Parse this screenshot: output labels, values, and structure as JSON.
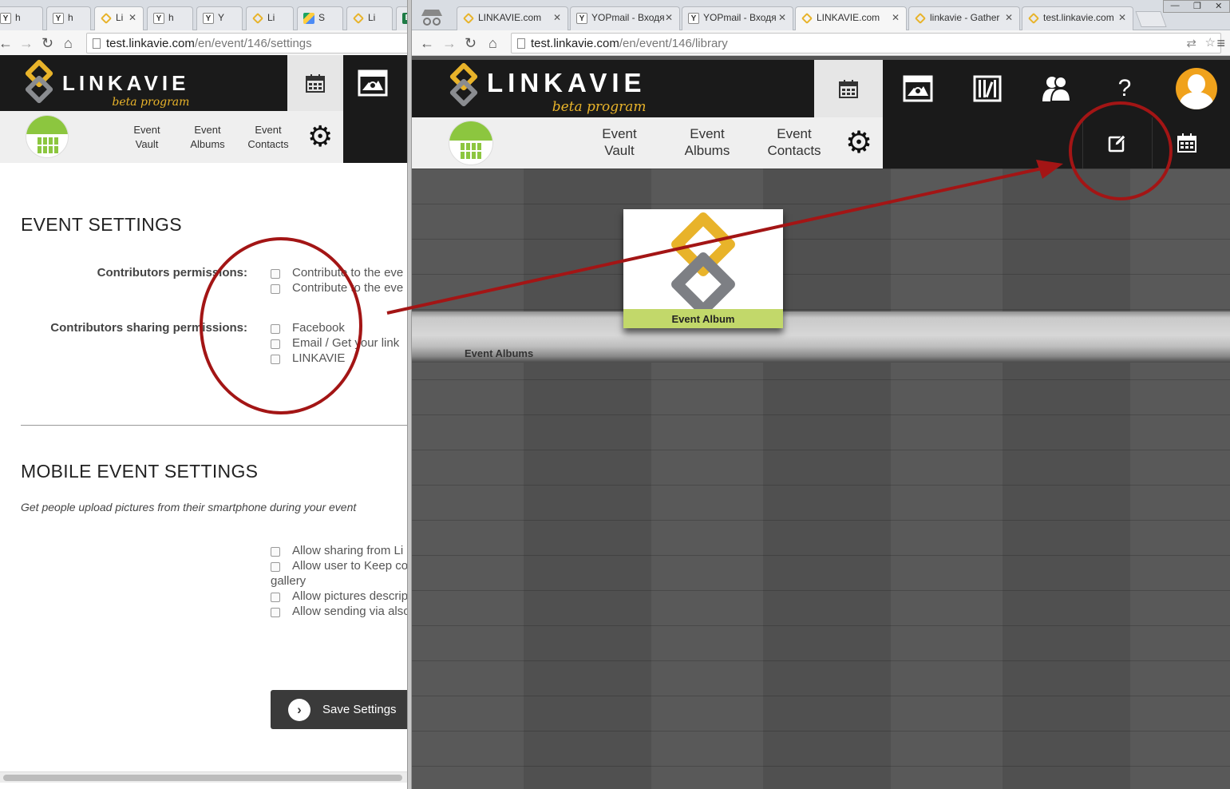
{
  "left_window": {
    "tabs": [
      {
        "icon": "Y",
        "label": "h"
      },
      {
        "icon": "Y",
        "label": "h"
      },
      {
        "icon": "L",
        "label": "Li"
      },
      {
        "icon": "Y",
        "label": "h"
      },
      {
        "icon": "Y",
        "label": "Y"
      },
      {
        "icon": "L",
        "label": "Li"
      },
      {
        "icon": "G",
        "label": "S"
      },
      {
        "icon": "L",
        "label": "Li"
      },
      {
        "icon": "E",
        "label": ""
      }
    ],
    "url_host": "test.linkavie.com",
    "url_path": "/en/event/146/settings",
    "logo_text": "LINKAVIE",
    "logo_beta": "beta program",
    "subnav": [
      {
        "line1": "Event",
        "line2": "Vault"
      },
      {
        "line1": "Event",
        "line2": "Albums"
      },
      {
        "line1": "Event",
        "line2": "Contacts"
      }
    ],
    "event_settings_title": "EVENT SETTINGS",
    "contrib_perm_label": "Contributors permissions:",
    "contrib_perm_options": [
      "Contribute to the eve",
      "Contribute to the eve"
    ],
    "sharing_perm_label": "Contributors sharing permissions:",
    "sharing_perm_options": [
      "Facebook",
      "Email / Get your link",
      "LINKAVIE"
    ],
    "mobile_title": "MOBILE EVENT SETTINGS",
    "mobile_note": "Get people upload pictures from their smartphone during your event",
    "mobile_options": [
      "Allow sharing from Li",
      "Allow user to Keep co",
      "Allow pictures descrip",
      "Allow sending via also"
    ],
    "mobile_wrap": "gallery",
    "save_label": "Save Settings"
  },
  "right_window": {
    "tabs": [
      {
        "label": "LINKAVIE.com"
      },
      {
        "label": "YOPmail - Входя"
      },
      {
        "label": "YOPmail - Входя"
      },
      {
        "label": "LINKAVIE.com"
      },
      {
        "label": "linkavie - Gather"
      },
      {
        "label": "test.linkavie.com"
      }
    ],
    "url_host": "test.linkavie.com",
    "url_path": "/en/event/146/library",
    "logo_text": "LINKAVIE",
    "logo_beta": "beta program",
    "subnav": [
      {
        "line1": "Event",
        "line2": "Vault"
      },
      {
        "line1": "Event",
        "line2": "Albums"
      },
      {
        "line1": "Event",
        "line2": "Contacts"
      }
    ],
    "help_glyph": "?",
    "album_caption": "Event Album",
    "shelf_label": "Event Albums"
  },
  "annotation": {
    "color": "#a31515"
  },
  "colors": {
    "brand_yellow": "#e8b32a",
    "brand_green": "#8cc63f",
    "header_black": "#1a1a1a"
  }
}
